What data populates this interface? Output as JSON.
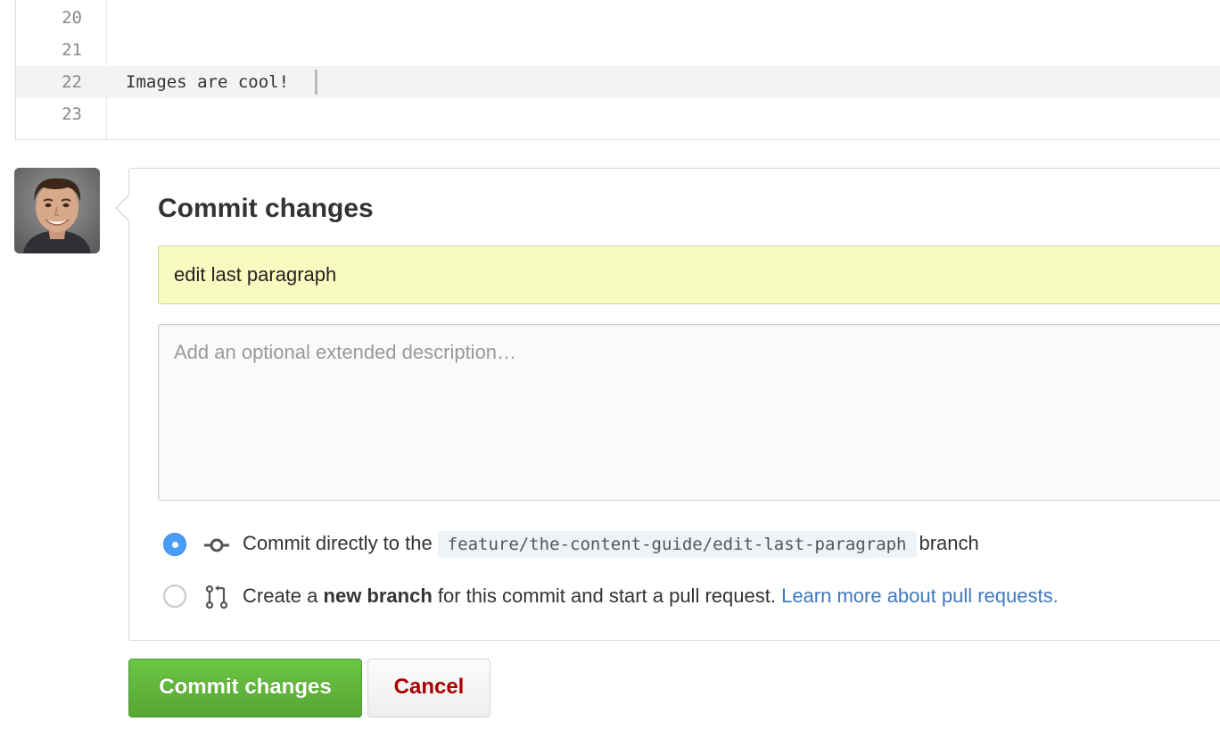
{
  "editor": {
    "lines": [
      {
        "number": "20",
        "text": ""
      },
      {
        "number": "21",
        "text": ""
      },
      {
        "number": "22",
        "text": "Images are cool!"
      },
      {
        "number": "23",
        "text": ""
      }
    ]
  },
  "commit": {
    "title": "Commit changes",
    "summary_value": "edit last paragraph",
    "description_placeholder": "Add an optional extended description…",
    "option_direct": {
      "prefix": "Commit directly to the",
      "branch": "feature/the-content-guide/edit-last-paragraph",
      "suffix": "branch"
    },
    "option_new_branch": {
      "prefix": "Create a",
      "bold": "new branch",
      "middle": "for this commit and start a pull request.",
      "link": "Learn more about pull requests."
    }
  },
  "buttons": {
    "commit_label": "Commit changes",
    "cancel_label": "Cancel"
  },
  "colors": {
    "commit_button": "#6cc644",
    "cancel_text": "#aa0000",
    "radio_checked": "#4a9df7",
    "summary_bg": "#f7fbbf",
    "link": "#4078c0"
  }
}
